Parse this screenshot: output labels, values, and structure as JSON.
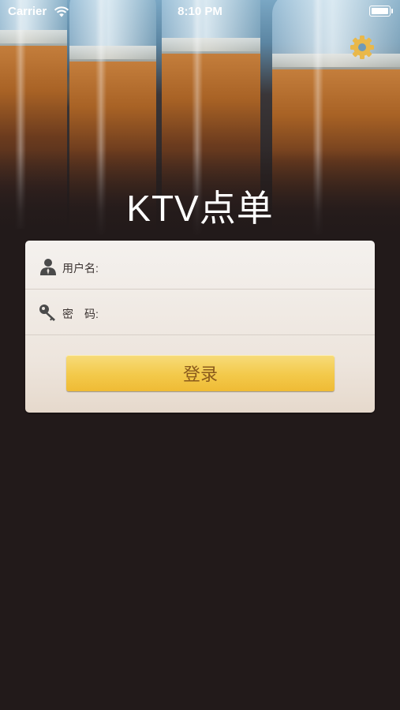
{
  "status_bar": {
    "carrier": "Carrier",
    "time": "8:10 PM"
  },
  "header": {
    "title": "KTV点单",
    "settings_icon": "gear-icon"
  },
  "login_form": {
    "username_label": "用户名:",
    "username_value": "",
    "username_icon": "user-icon",
    "password_label": "密　码:",
    "password_value": "",
    "password_icon": "key-icon",
    "login_button_label": "登录"
  },
  "colors": {
    "background": "#221a1a",
    "button": "#f3c94a",
    "button_text": "#8a5a1c",
    "gear": "#e9b84a"
  }
}
